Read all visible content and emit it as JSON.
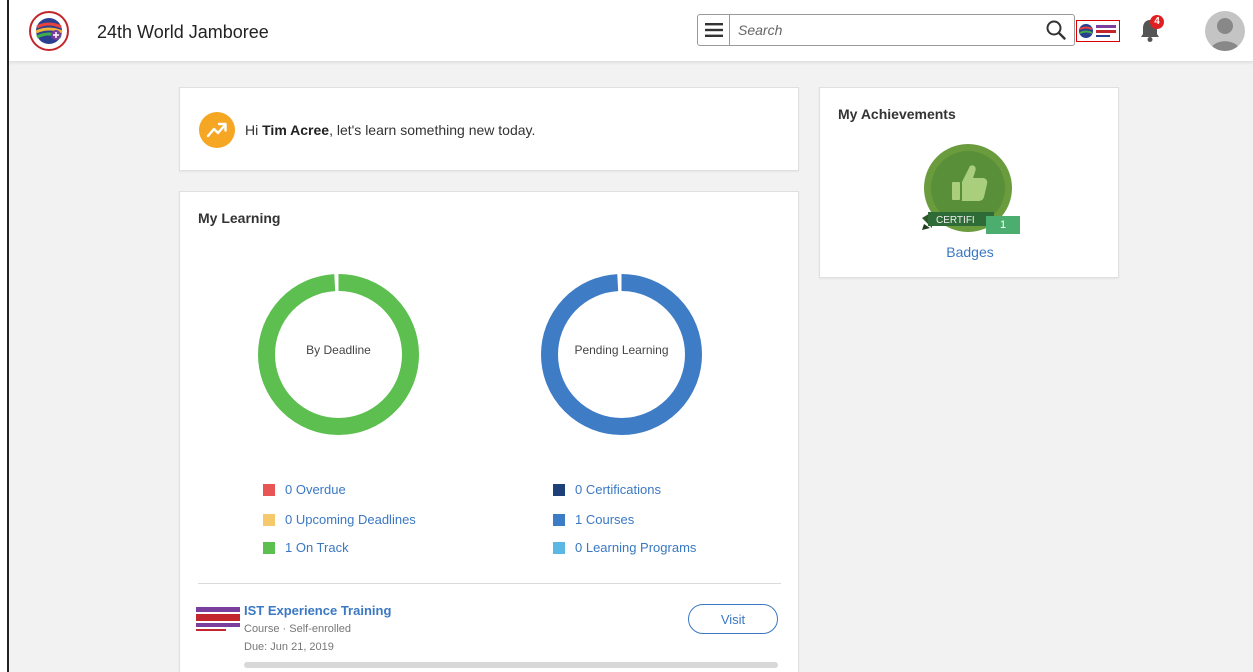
{
  "header": {
    "app_title": "24th World Jamboree",
    "search_placeholder": "Search",
    "notification_count": "4",
    "icons": [
      "menu-icon",
      "search-icon",
      "bell-icon",
      "avatar-icon"
    ]
  },
  "greeting": {
    "prefix": "Hi ",
    "name": "Tim Acree",
    "suffix": ",  let's learn something new today."
  },
  "my_learning": {
    "title": "My Learning",
    "deadline_donut": {
      "label": "By Deadline",
      "color": "#5cbf4f"
    },
    "pending_donut": {
      "label": "Pending Learning",
      "color": "#3f7cc6"
    },
    "deadline_legend": [
      {
        "label": "0 Overdue",
        "color": "#e85555"
      },
      {
        "label": "0 Upcoming Deadlines",
        "color": "#f5c96b"
      },
      {
        "label": "1 On Track",
        "color": "#5cbf4f"
      }
    ],
    "pending_legend": [
      {
        "label": "0 Certifications",
        "color": "#1f3f78"
      },
      {
        "label": "1 Courses",
        "color": "#3f7cc6"
      },
      {
        "label": "0 Learning Programs",
        "color": "#5bb8e3"
      }
    ],
    "course": {
      "title": "IST Experience Training",
      "meta": "Course · Self-enrolled",
      "due": "Due: Jun 21, 2019",
      "visit_label": "Visit",
      "progress": 0
    }
  },
  "achievements": {
    "title": "My Achievements",
    "badge_ribbon": "CERTIFI",
    "badge_count": "1",
    "badges_link": "Badges"
  },
  "colors": {
    "accent": "#3a78c3",
    "greeting_icon": "#f5a623",
    "badge_green": "#5a8f3a"
  }
}
